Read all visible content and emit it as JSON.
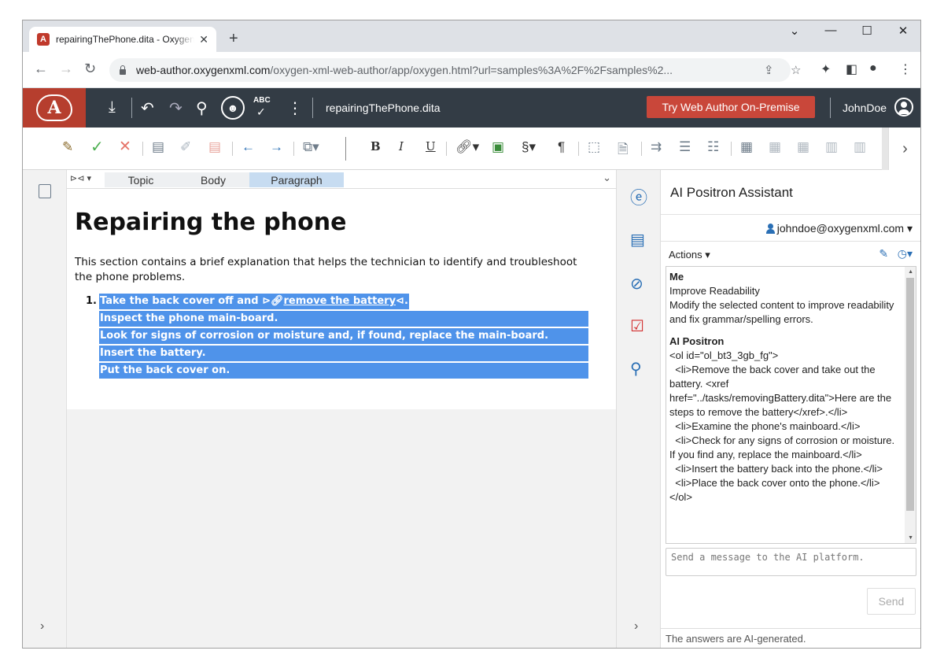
{
  "browser": {
    "tab_title": "repairingThePhone.dita - Oxygen XML Web Author",
    "tab_favicon": "A",
    "new_tab": "+",
    "url_host": "web-author.oxygenxml.com",
    "url_path": "/oxygen-xml-web-author/app/oxygen.html?url=samples%3A%2F%2Fsamples%2..."
  },
  "oxygen": {
    "logo": "A",
    "doc_name": "repairingThePhone.dita",
    "try_button": "Try Web Author On-Premise",
    "username": "JohnDoe",
    "spell_label": "ABC"
  },
  "breadcrumb": [
    "Topic",
    "Body",
    "Paragraph"
  ],
  "document": {
    "title": "Repairing the phone",
    "paragraph": "This section contains a brief explanation that helps the technician to identify and troubleshoot the phone problems.",
    "list_number": "1.",
    "list_items": [
      "Take the back cover off and",
      "Inspect the phone main-board.",
      "Look for signs of corrosion or moisture and, if found, replace the main-board.",
      "Insert the battery.",
      "Put the back cover on."
    ],
    "link_text": "remove the battery",
    "link_end": "."
  },
  "ai": {
    "title": "AI Positron Assistant",
    "user_email": "johndoe@oxygenxml.com",
    "actions_label": "Actions",
    "me_label": "Me",
    "me_action": "Improve Readability",
    "me_text": "Modify the selected content to improve readability and fix grammar/spelling errors.",
    "bot_label": "AI Positron",
    "bot_text": "<ol id=\"ol_bt3_3gb_fg\">\n  <li>Remove the back cover and take out the battery. <xref href=\"../tasks/removingBattery.dita\">Here are the steps to remove the battery</xref>.</li>\n  <li>Examine the phone's mainboard.</li>\n  <li>Check for any signs of corrosion or moisture. If you find any, replace the mainboard.</li>\n  <li>Insert the battery back into the phone.</li>\n  <li>Place the back cover onto the phone.</li>\n</ol>",
    "input_placeholder": "Send a message to the AI platform.",
    "send_label": "Send",
    "footer": "The answers are AI-generated."
  }
}
